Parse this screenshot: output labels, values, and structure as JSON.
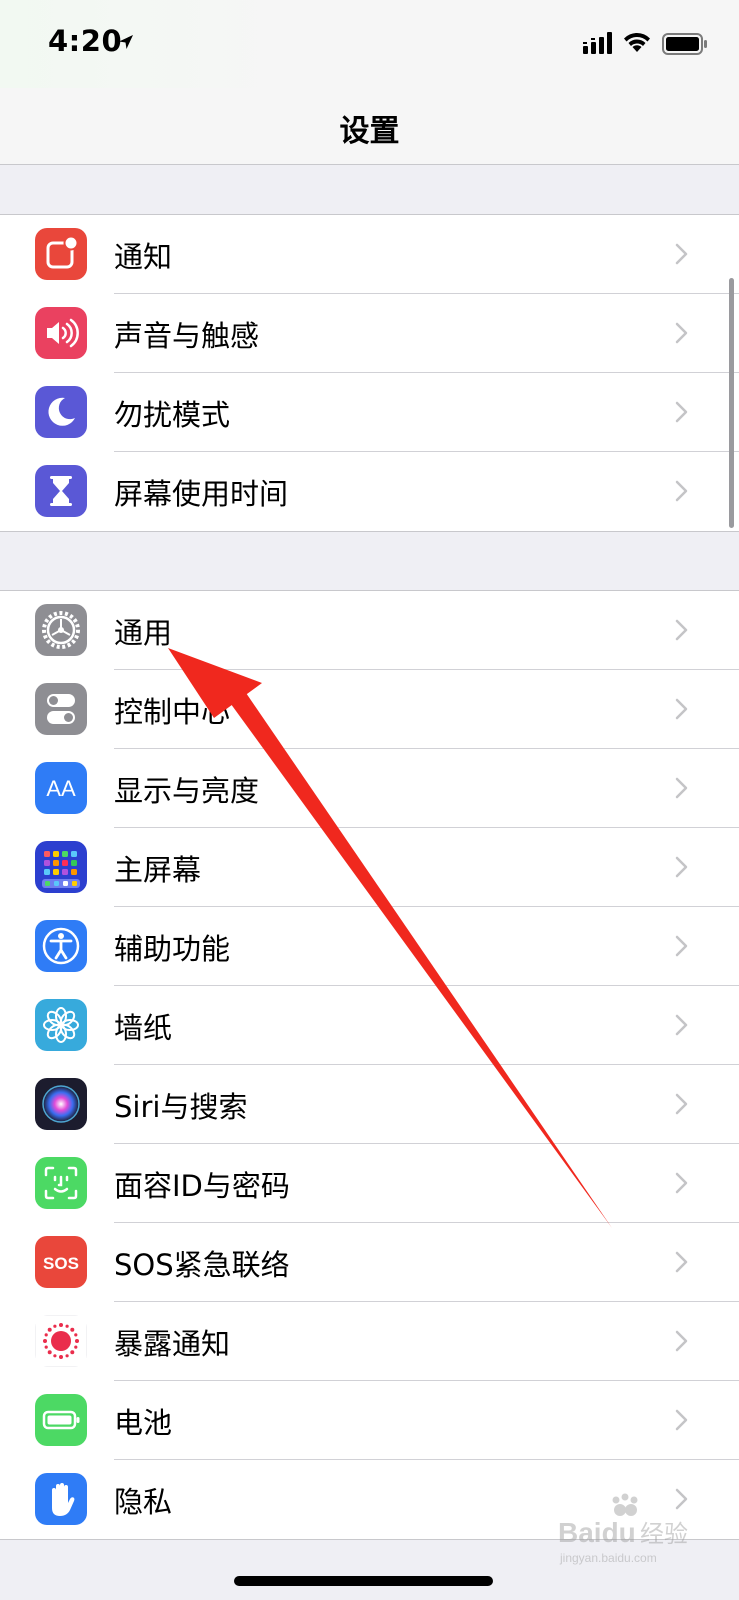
{
  "status_bar": {
    "time": "4:20",
    "icons": [
      "location-arrow-icon",
      "cellular-signal-icon",
      "wifi-icon",
      "battery-icon"
    ]
  },
  "nav": {
    "title": "设置"
  },
  "groups": [
    {
      "items": [
        {
          "label": "通知",
          "icon": "notifications-icon",
          "color": "#e9473b"
        },
        {
          "label": "声音与触感",
          "icon": "sounds-icon",
          "color": "#ea4160"
        },
        {
          "label": "勿扰模式",
          "icon": "do-not-disturb-icon",
          "color": "#5a58d6"
        },
        {
          "label": "屏幕使用时间",
          "icon": "screen-time-icon",
          "color": "#5a58d6"
        }
      ]
    },
    {
      "items": [
        {
          "label": "通用",
          "icon": "general-gear-icon",
          "color": "#8e8e93"
        },
        {
          "label": "控制中心",
          "icon": "control-center-icon",
          "color": "#8e8e93"
        },
        {
          "label": "显示与亮度",
          "icon": "display-brightness-icon",
          "color": "#2f7cf6"
        },
        {
          "label": "主屏幕",
          "icon": "home-screen-icon",
          "color": "#2c3fcf"
        },
        {
          "label": "辅助功能",
          "icon": "accessibility-icon",
          "color": "#2f7cf6"
        },
        {
          "label": "墙纸",
          "icon": "wallpaper-icon",
          "color": "#37aadc"
        },
        {
          "label": "Siri与搜索",
          "icon": "siri-icon",
          "color": "#1c1c2e"
        },
        {
          "label": "面容ID与密码",
          "icon": "face-id-icon",
          "color": "#4cd964"
        },
        {
          "label": "SOS紧急联络",
          "icon": "sos-icon",
          "color": "#e9473b"
        },
        {
          "label": "暴露通知",
          "icon": "exposure-notification-icon",
          "color": "#ffffff"
        },
        {
          "label": "电池",
          "icon": "battery-settings-icon",
          "color": "#4cd964"
        },
        {
          "label": "隐私",
          "icon": "privacy-hand-icon",
          "color": "#2f7cf6"
        }
      ]
    }
  ],
  "icon_text": {
    "display": "AA",
    "sos": "SOS"
  },
  "annotation": {
    "icon": "red-arrow-annotation-icon",
    "color": "#f0281e"
  },
  "watermark": {
    "brand": "Baidu",
    "brand_cn": "经验",
    "url": "jingyan.baidu.com"
  }
}
